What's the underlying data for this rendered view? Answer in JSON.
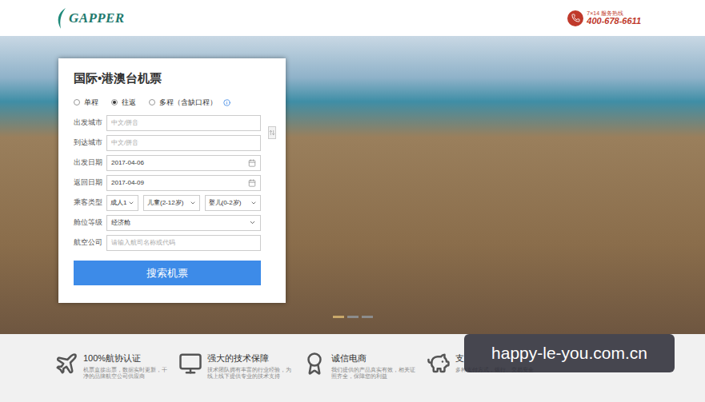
{
  "header": {
    "logo": "GAPPER",
    "hotline_label": "7×14 服务热线",
    "hotline": "400-678-6611"
  },
  "form": {
    "title": "国际•港澳台机票",
    "trip_types": [
      {
        "label": "单程",
        "selected": false
      },
      {
        "label": "往返",
        "selected": true
      },
      {
        "label": "多程（含缺口程）",
        "selected": false
      }
    ],
    "fields": [
      {
        "kind": "text",
        "label": "出发城市",
        "value": "",
        "placeholder": "中文/拼音"
      },
      {
        "kind": "text",
        "label": "到达城市",
        "value": "",
        "placeholder": "中文/拼音"
      },
      {
        "kind": "date",
        "label": "出发日期",
        "value": "2017-04-06",
        "placeholder": ""
      },
      {
        "kind": "date",
        "label": "返回日期",
        "value": "2017-04-09",
        "placeholder": ""
      },
      {
        "kind": "passengers",
        "label": "乘客类型",
        "options": [
          "成人1",
          "儿童(2-12岁)",
          "婴儿(0-2岁)"
        ]
      },
      {
        "kind": "select",
        "label": "舱位等级",
        "value": "经济舱",
        "placeholder": ""
      },
      {
        "kind": "text",
        "label": "航空公司",
        "value": "",
        "placeholder": "请输入航司名称或代码"
      }
    ],
    "button": "搜索机票"
  },
  "carousel": {
    "dots": [
      {
        "selected": true
      },
      {
        "selected": false
      },
      {
        "selected": false
      }
    ]
  },
  "features": [
    {
      "title": "100%航协认证",
      "desc": "机票直接出票，数据实时更新，干净的品牌航空公司供应商"
    },
    {
      "title": "强大的技术保障",
      "desc": "技术团队拥有丰富的行业经验，为线上线下提供专业的技术支持"
    },
    {
      "title": "诚信电商",
      "desc": "我们提供的产品真实有效，相关证照齐全，保障您的利益"
    },
    {
      "title": "支",
      "desc": "多种支付方式，银行、交易安全"
    }
  ],
  "watermark": "happy-le-you.com.cn"
}
